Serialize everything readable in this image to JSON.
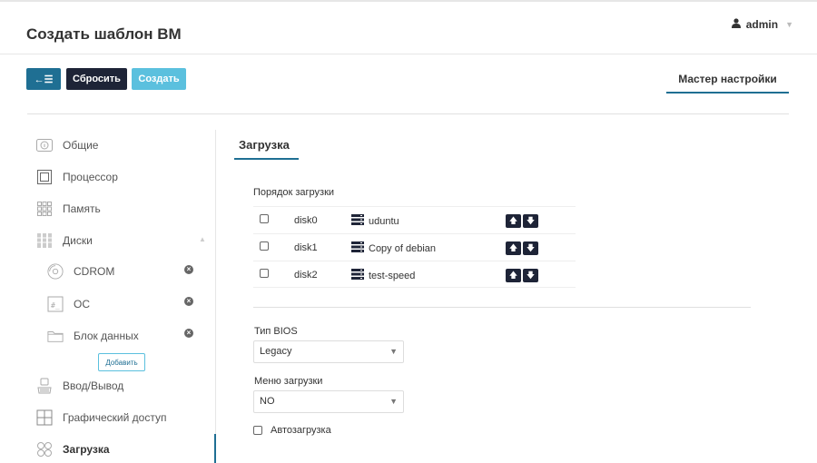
{
  "header": {
    "title": "Создать шаблон ВМ",
    "user": "admin"
  },
  "toolbar": {
    "back_label": "←☰",
    "reset_label": "Сбросить",
    "create_label": "Создать",
    "wizard_label": "Мастер настройки"
  },
  "sidebar": {
    "items": [
      {
        "label": "Общие",
        "icon": "info-icon"
      },
      {
        "label": "Процессор",
        "icon": "cpu-icon"
      },
      {
        "label": "Память",
        "icon": "memory-icon"
      },
      {
        "label": "Диски",
        "icon": "disks-icon"
      },
      {
        "label": "CDROM",
        "icon": "cdrom-icon"
      },
      {
        "label": "ОС",
        "icon": "os-icon"
      },
      {
        "label": "Блок данных",
        "icon": "folder-icon"
      },
      {
        "label": "Ввод/Вывод",
        "icon": "io-icon"
      },
      {
        "label": "Графический доступ",
        "icon": "graphics-icon"
      },
      {
        "label": "Загрузка",
        "icon": "boot-icon"
      }
    ],
    "add_label": "Добавить"
  },
  "boot": {
    "section_title": "Загрузка",
    "order_label": "Порядок загрузки",
    "rows": [
      {
        "device": "disk0",
        "disk": "uduntu"
      },
      {
        "device": "disk1",
        "disk": "Copy of debian"
      },
      {
        "device": "disk2",
        "disk": "test-speed"
      }
    ],
    "bios_label": "Тип BIOS",
    "bios_value": "Legacy",
    "menu_label": "Меню загрузки",
    "menu_value": "NO",
    "autoload_label": "Автозагрузка"
  },
  "colors": {
    "accent": "#1f6f93",
    "dark": "#1e2437",
    "light_blue": "#5bc0de"
  }
}
